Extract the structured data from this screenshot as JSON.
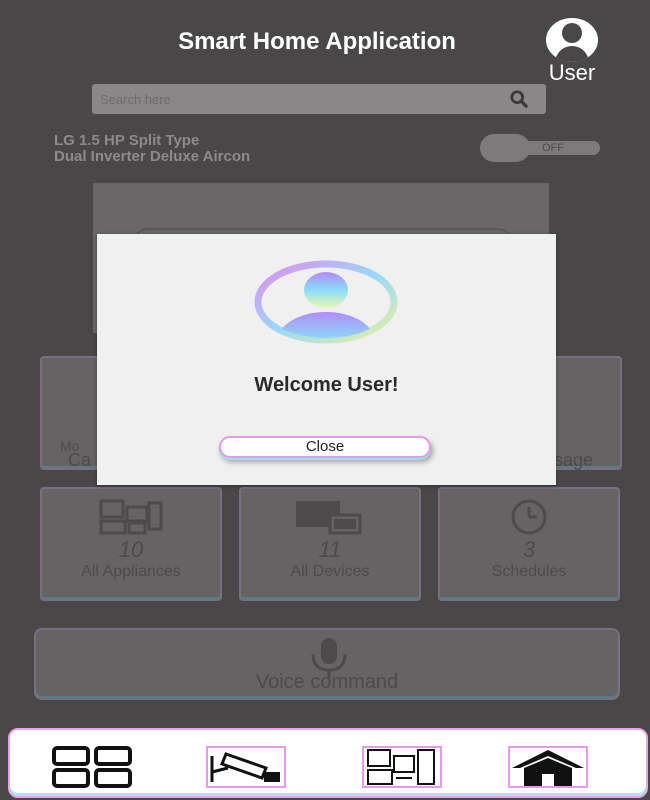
{
  "header": {
    "title": "Smart Home Application",
    "user_label": "User"
  },
  "search": {
    "placeholder": "Search here"
  },
  "device": {
    "name_line1": "LG 1.5 HP Split Type",
    "name_line2": "Dual Inverter Deluxe Aircon",
    "toggle_state": "OFF"
  },
  "stats": [
    {
      "value": "10",
      "label": "All Appliances",
      "icon": "appliances-icon"
    },
    {
      "value": "11",
      "label": "All Devices",
      "icon": "devices-icon"
    },
    {
      "value": "3",
      "label": "Schedules",
      "icon": "clock-icon"
    }
  ],
  "partial_cards": {
    "left_text": "Mo",
    "left_text2": "Ca",
    "right_text": "sage"
  },
  "voice": {
    "label": "Voice command",
    "icon": "microphone-icon"
  },
  "bottom_nav": [
    {
      "name": "dashboard",
      "icon": "grid-icon"
    },
    {
      "name": "cameras",
      "icon": "security-camera-icon"
    },
    {
      "name": "appliances",
      "icon": "appliances-icon"
    },
    {
      "name": "home",
      "icon": "home-icon"
    }
  ],
  "modal": {
    "welcome_text": "Welcome User!",
    "close_label": "Close"
  },
  "colors": {
    "background": "#4a4748",
    "modal_bg": "#f1f0f1",
    "accent_pink": "#e49ae8",
    "accent_cyan": "#9ae0e8"
  }
}
